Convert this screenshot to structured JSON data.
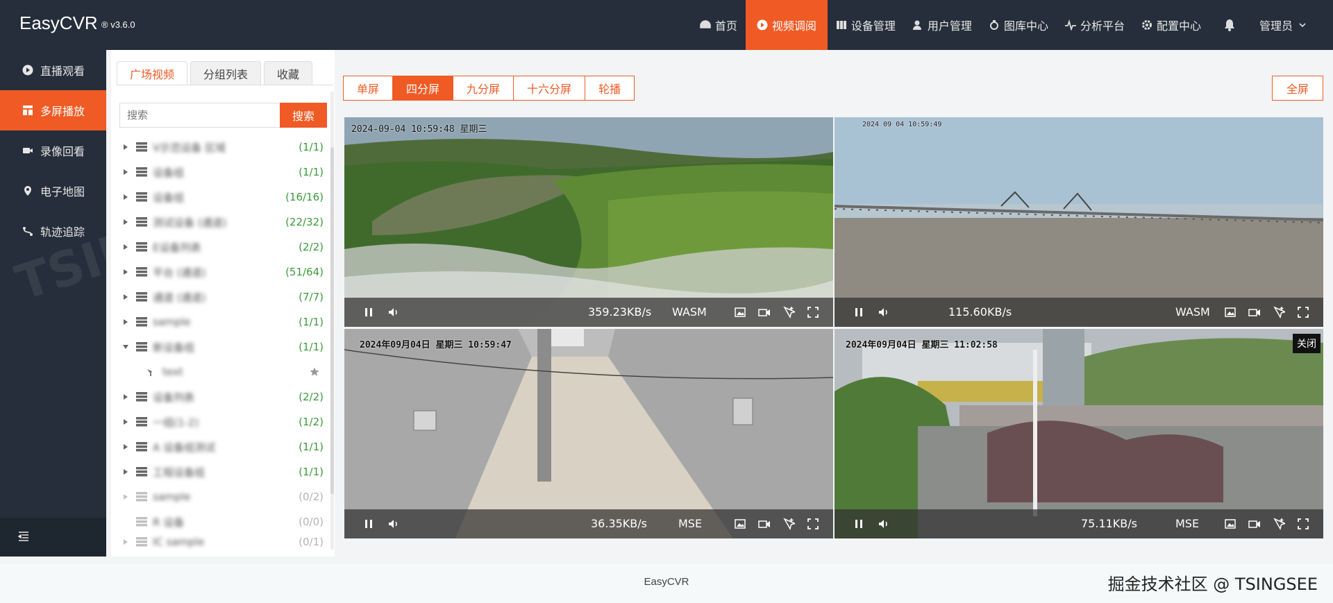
{
  "app": {
    "title": "EasyCVR",
    "version": "® v3.6.0"
  },
  "topnav": [
    {
      "label": "首页",
      "icon": "dashboard-icon",
      "active": false
    },
    {
      "label": "视频调阅",
      "icon": "play-circle-icon",
      "active": true
    },
    {
      "label": "设备管理",
      "icon": "device-icon",
      "active": false
    },
    {
      "label": "用户管理",
      "icon": "user-icon",
      "active": false
    },
    {
      "label": "图库中心",
      "icon": "gallery-icon",
      "active": false
    },
    {
      "label": "分析平台",
      "icon": "pulse-icon",
      "active": false
    },
    {
      "label": "配置中心",
      "icon": "gear-icon",
      "active": false
    }
  ],
  "user": {
    "name": "管理员"
  },
  "sidebar": {
    "items": [
      {
        "label": "直播观看",
        "icon": "play-icon"
      },
      {
        "label": "多屏播放",
        "icon": "grid-icon",
        "active": true
      },
      {
        "label": "录像回看",
        "icon": "camera-icon"
      },
      {
        "label": "电子地图",
        "icon": "map-pin-icon"
      },
      {
        "label": "轨迹追踪",
        "icon": "track-icon"
      }
    ]
  },
  "panel": {
    "tabs": [
      "广场视频",
      "分组列表",
      "收藏"
    ],
    "search_placeholder": "搜索",
    "search_button": "搜索",
    "tree": [
      {
        "name": "V示范设备 区域",
        "count": "(1/1)"
      },
      {
        "name": "设备组",
        "count": "(1/1)"
      },
      {
        "name": "设备组",
        "count": "(16/16)"
      },
      {
        "name": "测试设备 (通道)",
        "count": "(22/32)"
      },
      {
        "name": "E设备列表",
        "count": "(2/2)"
      },
      {
        "name": "平台 (通道)",
        "count": "(51/64)"
      },
      {
        "name": "通道 (通道)",
        "count": "(7/7)"
      },
      {
        "name": "sample",
        "count": "(1/1)"
      },
      {
        "name": "新设备组",
        "count": "(1/1)",
        "expanded": true
      },
      {
        "name": "text",
        "child": true
      },
      {
        "name": "设备列表",
        "count": "(2/2)"
      },
      {
        "name": "一组(1-2)",
        "count": "(1/2)"
      },
      {
        "name": "A 设备组测试",
        "count": "(1/1)"
      },
      {
        "name": "工程设备组",
        "count": "(1/1)"
      },
      {
        "name": "sample",
        "count": "(0/2)",
        "dim": true
      },
      {
        "name": "R 设备",
        "count": "(0/0)",
        "dim": true
      },
      {
        "name": "IC sample",
        "count": "(0/1)",
        "dim": true
      }
    ]
  },
  "layouts": [
    "单屏",
    "四分屏",
    "九分屏",
    "十六分屏",
    "轮播"
  ],
  "active_layout": "四分屏",
  "fullscreen_label": "全屏",
  "players": [
    {
      "osd": "2024-09-04 10:59:48 星期三",
      "rate": "359.23KB/s",
      "protocol": "WASM"
    },
    {
      "osd": "2024 09 04 10:59:49",
      "rate": "115.60KB/s",
      "protocol": "WASM"
    },
    {
      "osd": "2024年09月04日 星期三 10:59:47",
      "rate": "36.35KB/s",
      "protocol": "MSE"
    },
    {
      "osd": "2024年09月04日 星期三 11:02:58",
      "rate": "75.11KB/s",
      "protocol": "MSE",
      "close_label": "关闭"
    }
  ],
  "footer": {
    "text": "EasyCVR",
    "credit": "掘金技术社区 @ TSINGSEE"
  },
  "colors": {
    "accent": "#f05a24",
    "dark": "#252e3a",
    "count_green": "#3a9a3a"
  }
}
